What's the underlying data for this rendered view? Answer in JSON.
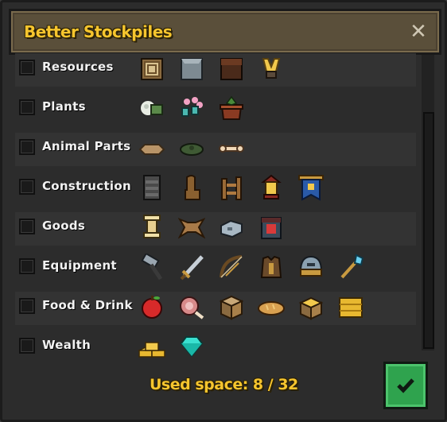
{
  "window": {
    "title": "Better Stockpiles",
    "close_glyph": "✕"
  },
  "categories": [
    {
      "label": "Resources",
      "checked": false,
      "icons": [
        "wood-log-icon",
        "stone-block-icon",
        "dark-wood-icon",
        "gold-ore-icon"
      ]
    },
    {
      "label": "Plants",
      "checked": false,
      "icons": [
        "cotton-bundle-icon",
        "flower-seeds-icon",
        "potted-plant-icon"
      ]
    },
    {
      "label": "Animal Parts",
      "checked": false,
      "icons": [
        "hide-icon",
        "turtle-shell-icon",
        "bone-icon"
      ]
    },
    {
      "label": "Construction",
      "checked": false,
      "icons": [
        "door-panel-icon",
        "chair-icon",
        "fence-icon",
        "lantern-icon",
        "banner-icon"
      ]
    },
    {
      "label": "Goods",
      "checked": false,
      "icons": [
        "pedestal-icon",
        "pelt-icon",
        "metal-bar-icon",
        "gem-box-icon"
      ]
    },
    {
      "label": "Equipment",
      "checked": false,
      "icons": [
        "hammer-icon",
        "sword-icon",
        "bow-icon",
        "leather-armor-icon",
        "helmet-icon",
        "staff-icon"
      ]
    },
    {
      "label": "Food & Drink",
      "checked": false,
      "icons": [
        "apple-icon",
        "ham-icon",
        "crate-icon",
        "bread-icon",
        "grain-crate-icon",
        "hay-bale-icon"
      ]
    },
    {
      "label": "Wealth",
      "checked": false,
      "icons": [
        "gold-bars-icon",
        "diamond-icon"
      ]
    }
  ],
  "footer": {
    "used_space_label": "Used space: 8 / 32",
    "confirm_glyph": "✓"
  },
  "colors": {
    "title": "#f6c52e",
    "confirm": "#2fa34e",
    "row_alt": "#333333"
  }
}
